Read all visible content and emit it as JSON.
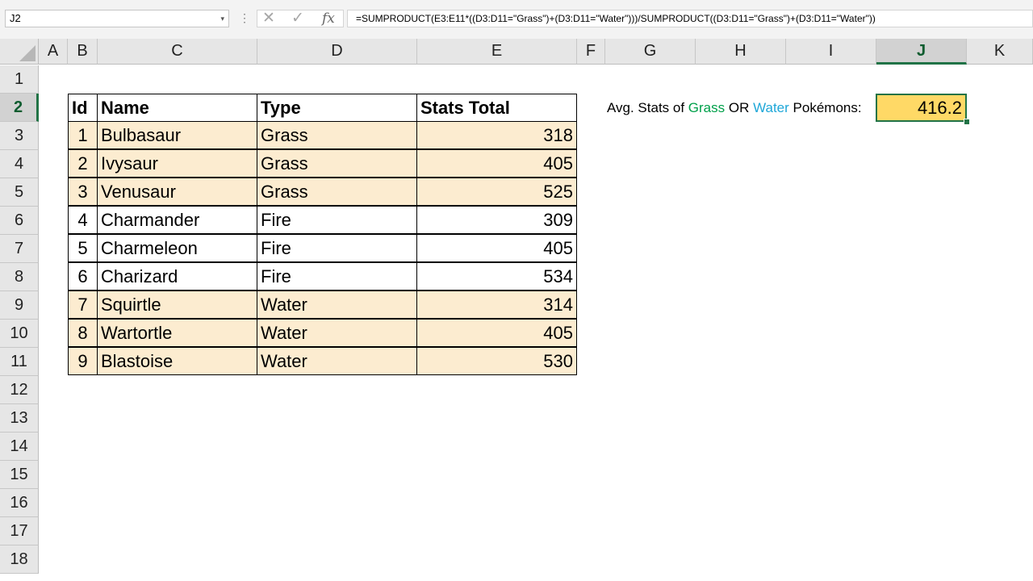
{
  "formula_bar": {
    "name_box": "J2",
    "formula": "=SUMPRODUCT(E3:E11*((D3:D11=\"Grass\")+(D3:D11=\"Water\")))/SUMPRODUCT((D3:D11=\"Grass\")+(D3:D11=\"Water\"))",
    "cancel_icon": "✕",
    "enter_icon": "✓",
    "fx_label": "fx",
    "more_icon": "⋮",
    "dropdown_icon": "▾"
  },
  "columns": [
    "A",
    "B",
    "C",
    "D",
    "E",
    "F",
    "G",
    "H",
    "I",
    "J",
    "K"
  ],
  "selected_column": "J",
  "rows": [
    "1",
    "2",
    "3",
    "4",
    "5",
    "6",
    "7",
    "8",
    "9",
    "10",
    "11",
    "12",
    "13",
    "14",
    "15",
    "16",
    "17",
    "18"
  ],
  "selected_row": "2",
  "table": {
    "headers": [
      "Id",
      "Name",
      "Type",
      "Stats Total"
    ],
    "rows": [
      {
        "id": "1",
        "name": "Bulbasaur",
        "type": "Grass",
        "total": "318",
        "highlight": true
      },
      {
        "id": "2",
        "name": "Ivysaur",
        "type": "Grass",
        "total": "405",
        "highlight": true
      },
      {
        "id": "3",
        "name": "Venusaur",
        "type": "Grass",
        "total": "525",
        "highlight": true
      },
      {
        "id": "4",
        "name": "Charmander",
        "type": "Fire",
        "total": "309",
        "highlight": false
      },
      {
        "id": "5",
        "name": "Charmeleon",
        "type": "Fire",
        "total": "405",
        "highlight": false
      },
      {
        "id": "6",
        "name": "Charizard",
        "type": "Fire",
        "total": "534",
        "highlight": false
      },
      {
        "id": "7",
        "name": "Squirtle",
        "type": "Water",
        "total": "314",
        "highlight": true
      },
      {
        "id": "8",
        "name": "Wartortle",
        "type": "Water",
        "total": "405",
        "highlight": true
      },
      {
        "id": "9",
        "name": "Blastoise",
        "type": "Water",
        "total": "530",
        "highlight": true
      }
    ]
  },
  "summary": {
    "label_prefix": "Avg. Stats of ",
    "grass": "Grass",
    "or": " OR ",
    "water": "Water",
    "label_suffix": " Pokémons:",
    "value": "416.2"
  },
  "colors": {
    "highlight_fill": "#fcecd0",
    "result_fill": "#ffd966",
    "grass_text": "#00a04a",
    "water_text": "#1ea7d8",
    "selection": "#217346"
  }
}
